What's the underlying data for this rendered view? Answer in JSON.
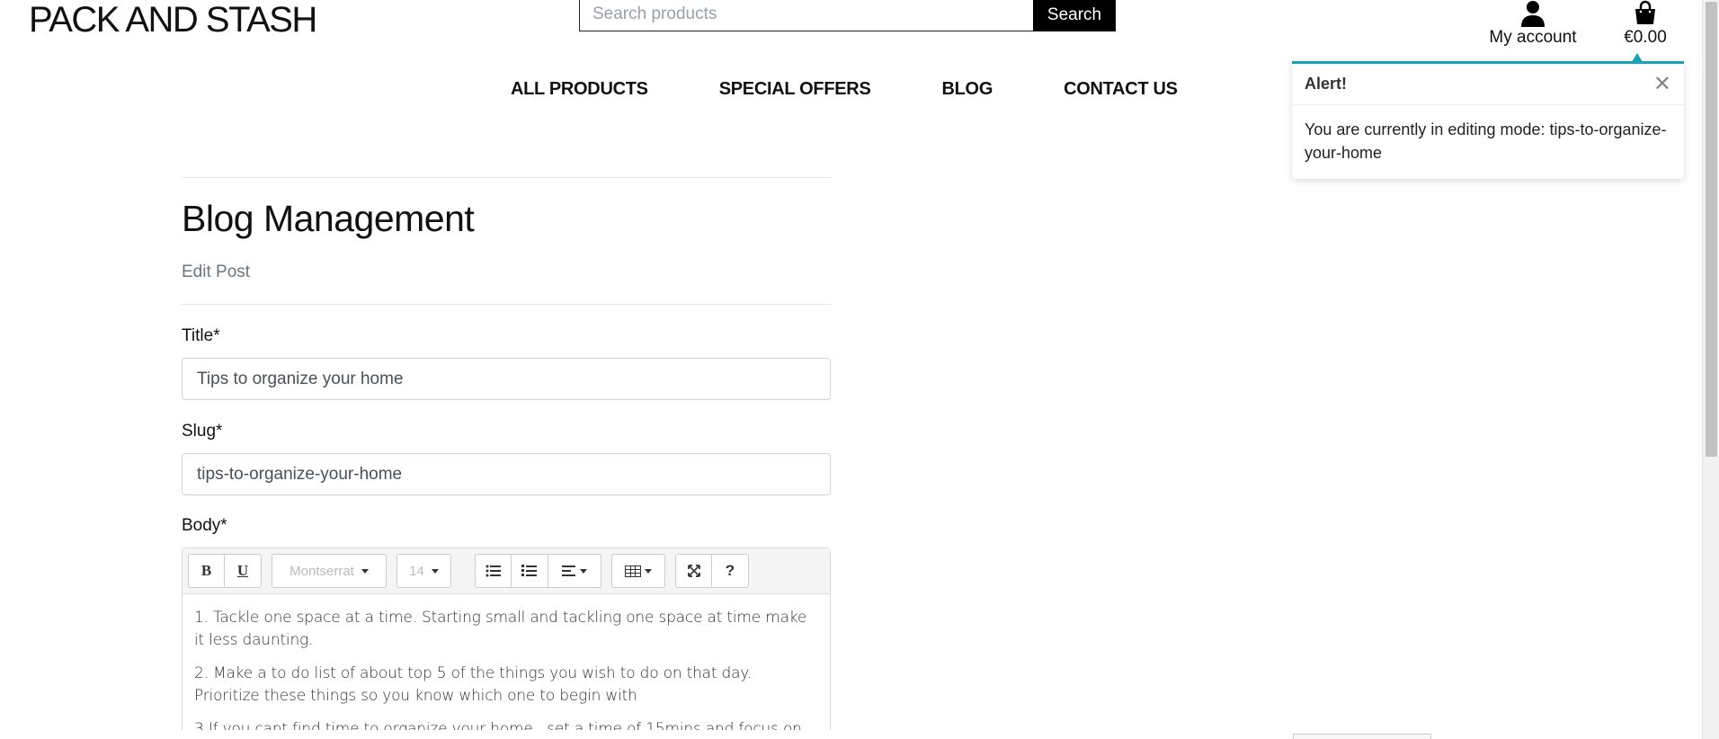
{
  "header": {
    "brand": "PACK AND STASH",
    "search": {
      "placeholder": "Search products",
      "button_label": "Search"
    },
    "account_label": "My account",
    "bag_total": "€0.00"
  },
  "nav": {
    "items": [
      "ALL PRODUCTS",
      "SPECIAL OFFERS",
      "BLOG",
      "CONTACT US"
    ]
  },
  "main": {
    "title": "Blog Management",
    "subtitle": "Edit Post",
    "fields": {
      "title_label": "Title*",
      "title_value": "Tips to organize your home",
      "slug_label": "Slug*",
      "slug_value": "tips-to-organize-your-home",
      "body_label": "Body*"
    },
    "editor": {
      "toolbar": {
        "bold": "B",
        "underline": "U",
        "font_name": "Montserrat",
        "font_size": "14",
        "help": "?"
      },
      "paragraphs": [
        "1. Tackle one space at a time. Starting small and tackling one space at time make it less daunting.",
        "2. Make a to do list of about top 5 of the things you wish to do on that day. Prioritize these things  so you know which one to begin with",
        "3.If you cant find time to organize your home , set a time of 15mins and focus on"
      ]
    }
  },
  "toast": {
    "title": "Alert!",
    "close": "✕",
    "message": "You are currently in editing mode: tips-to-organize-your-home"
  },
  "colors": {
    "toast_accent": "#17a2b8",
    "search_button": "#000000"
  }
}
